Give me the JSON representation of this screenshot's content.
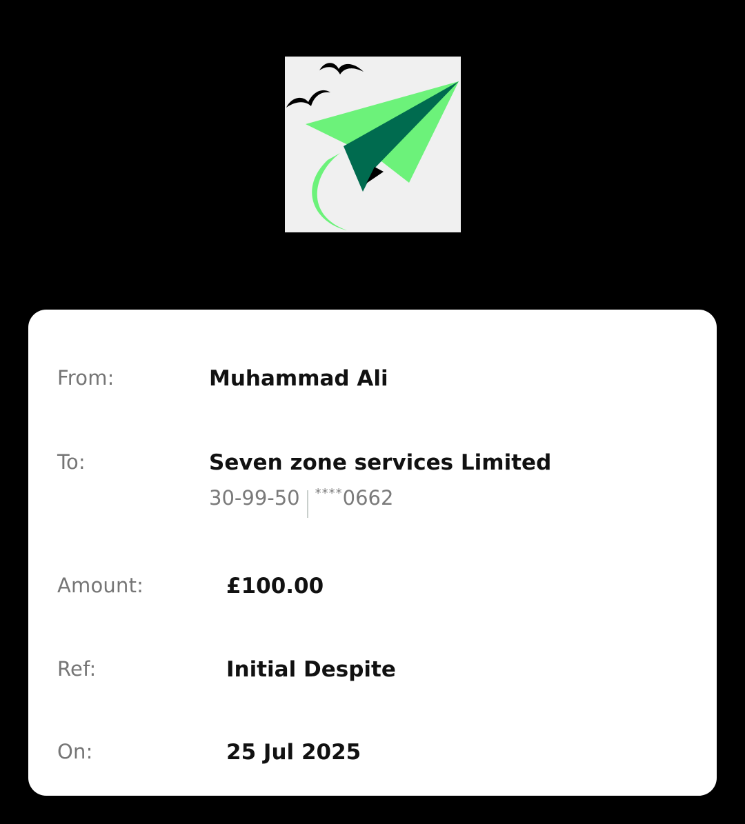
{
  "logo": {
    "icon": "paper-plane-icon"
  },
  "details": {
    "from_label": "From:",
    "from_value": "Muhammad Ali",
    "to_label": "To:",
    "to_value": "Seven zone services Limited",
    "sort_code": "30-99-50",
    "account_mask": "****",
    "account_suffix": "0662",
    "amount_label": "Amount:",
    "amount_value": "£100.00",
    "ref_label": "Ref:",
    "ref_value": "Initial Despite",
    "on_label": "On:",
    "on_value": "25 Jul 2025"
  },
  "colors": {
    "plane_light": "#6cf27a",
    "plane_dark": "#006b4f",
    "background": "#000000",
    "card": "#ffffff"
  }
}
